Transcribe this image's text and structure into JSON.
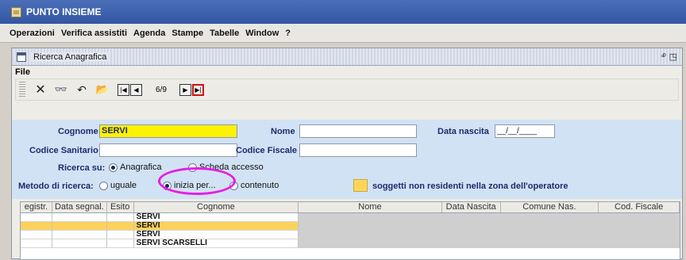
{
  "window": {
    "title": "PUNTO INSIEME"
  },
  "menu": [
    "Operazioni",
    "Verifica assistiti",
    "Agenda",
    "Stampe",
    "Tabelle",
    "Window",
    "?"
  ],
  "frame": {
    "title": "Ricerca Anagrafica",
    "file_menu": "File"
  },
  "toolbar": {
    "icons": [
      "delete-icon",
      "binoculars-search-icon",
      "undo-icon",
      "open-folder-icon"
    ],
    "pager": "6/9"
  },
  "form": {
    "cognome_label": "Cognome",
    "cognome_value": "SERVI",
    "nome_label": "Nome",
    "nome_value": "",
    "data_nascita_label": "Data nascita",
    "data_nascita_value": "__/__/____",
    "codice_sanitario_label": "Codice Sanitario",
    "codice_sanitario_value": "",
    "codice_fiscale_label": "Codice Fiscale",
    "codice_fiscale_value": "",
    "ricerca_su_label": "Ricerca su:",
    "ricerca_su_opt1": "Anagrafica",
    "ricerca_su_opt2": "Scheda accesso",
    "metodo_label": "Metodo di ricerca:",
    "metodo_opt1": "uguale",
    "metodo_opt2": "inizia per...",
    "metodo_opt3": "contenuto",
    "legend_text": "soggetti non residenti nella zona dell'operatore",
    "colors": {
      "panel": "#d2e2f5",
      "cognome_bg": "#fff200",
      "legend": "#ffd65a",
      "highlight_circle": "#e51ee4"
    }
  },
  "grid": {
    "columns": [
      "egistr.",
      "Data segnal.",
      "Esito",
      "Cognome",
      "Nome",
      "Data Nascita",
      "Comune Nas.",
      "Cod. Fiscale"
    ],
    "rows": [
      {
        "cognome": "SERVI",
        "highlight": false
      },
      {
        "cognome": "SERVI",
        "highlight": true
      },
      {
        "cognome": "SERVI",
        "highlight": false
      },
      {
        "cognome": "SERVI SCARSELLI",
        "highlight": false
      }
    ]
  }
}
